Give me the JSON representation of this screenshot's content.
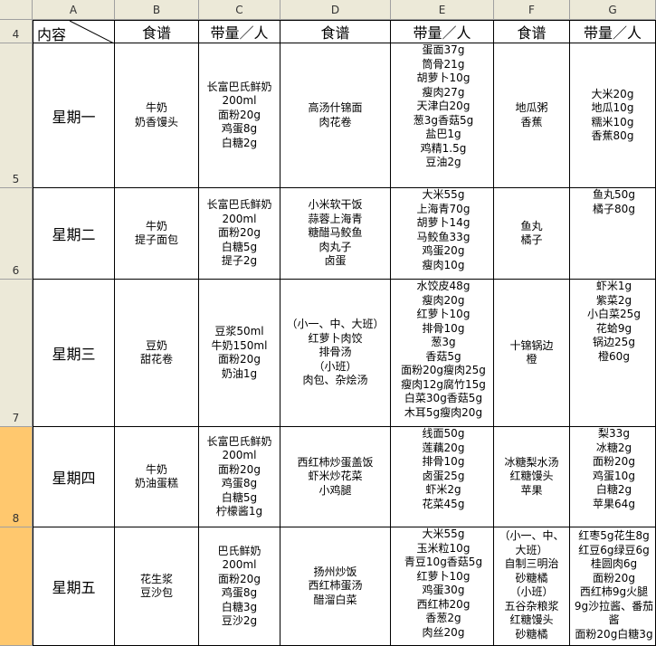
{
  "col_letters": [
    "A",
    "B",
    "C",
    "D",
    "E",
    "F",
    "G"
  ],
  "row_numbers": [
    "4",
    "5",
    "6",
    "7",
    "8"
  ],
  "header_row": {
    "a": "内容",
    "b": "食谱",
    "c": "带量／人",
    "d": "食谱",
    "e": "带量／人",
    "f": "食谱",
    "g": "带量／人"
  },
  "rows": [
    {
      "day": "星期一",
      "b": [
        "牛奶",
        "奶香馒头"
      ],
      "c": [
        "长富巴氏鲜奶",
        "200ml",
        "面粉20g",
        "鸡蛋8g",
        "白糖2g"
      ],
      "d": [
        "高汤什锦面",
        "肉花卷"
      ],
      "e": [
        "蛋面37g",
        "筒骨21g",
        "胡萝卜10g",
        "瘦肉27g",
        "天津白20g",
        "葱3g香菇5g",
        "盐巴1g",
        "鸡精1.5g",
        "豆油2g"
      ],
      "f": [
        "地瓜粥",
        "香蕉"
      ],
      "g": [
        "大米20g",
        "地瓜10g",
        "糯米10g",
        "香蕉80g"
      ]
    },
    {
      "day": "星期二",
      "b": [
        "牛奶",
        "提子面包"
      ],
      "c": [
        "长富巴氏鲜奶",
        "200ml",
        "面粉20g",
        "白糖5g",
        "提子2g"
      ],
      "d": [
        "小米软干饭",
        "蒜蓉上海青",
        "糖醋马鲛鱼",
        "肉丸子",
        "卤蛋"
      ],
      "e": [
        "大米55g",
        "上海青70g",
        "胡萝卜14g",
        "马鲛鱼33g",
        "鸡蛋20g",
        "瘦肉10g"
      ],
      "f": [
        "鱼丸",
        "橘子"
      ],
      "g": [
        "鱼丸50g",
        "橘子80g"
      ]
    },
    {
      "day": "星期三",
      "b": [
        "豆奶",
        "甜花卷"
      ],
      "c": [
        "豆浆50ml",
        "牛奶150ml",
        "面粉20g",
        "奶油1g"
      ],
      "d": [
        "（小一、中、大班）",
        "红萝卜肉饺",
        "排骨汤",
        "（小班）",
        "肉包、杂烩汤"
      ],
      "e": [
        "水饺皮48g",
        "瘦肉20g",
        "红萝卜10g",
        "排骨10g",
        "葱3g",
        "香菇5g",
        "面粉20g瘦肉25g",
        "瘦肉12g腐竹15g",
        "白菜30g香菇5g",
        "木耳5g瘦肉20g"
      ],
      "f": [
        "十锦锅边",
        "橙"
      ],
      "g": [
        "虾米1g",
        "紫菜2g",
        "小白菜25g",
        "花蛤9g",
        "锅边25g",
        "橙60g"
      ]
    },
    {
      "day": "星期四",
      "b": [
        "牛奶",
        "奶油蛋糕"
      ],
      "c": [
        "长富巴氏鲜奶",
        "200ml",
        "面粉20g",
        "鸡蛋8g",
        "白糖5g",
        "柠檬酱1g"
      ],
      "d": [
        "西红柿炒蛋盖饭",
        "虾米炒花菜",
        "小鸡腿"
      ],
      "e": [
        "线面50g",
        "莲藕20g",
        "排骨10g",
        "卤蛋25g",
        "虾米2g",
        "花菜45g"
      ],
      "f": [
        "冰糖梨水汤",
        "红糖馒头",
        "苹果"
      ],
      "g": [
        "梨33g",
        "冰糖2g",
        "面粉20g",
        "鸡蛋10g",
        "白糖2g",
        "苹果64g"
      ]
    },
    {
      "day": "星期五",
      "b": [
        "花生浆",
        "豆沙包"
      ],
      "c": [
        "巴氏鲜奶",
        "200ml",
        "面粉20g",
        "鸡蛋8g",
        "白糖3g",
        "豆沙2g"
      ],
      "d": [
        "扬州炒饭",
        "西红柿蛋汤",
        "醋溜白菜"
      ],
      "e": [
        "大米55g",
        "玉米粒10g",
        "青豆10g香菇5g",
        "红萝卜10g",
        "鸡蛋30g",
        "西红柿20g",
        "香葱2g",
        "肉丝20g"
      ],
      "f": [
        "（小一、中、",
        "大班）",
        "自制三明治",
        "砂糖橘",
        "（小班）",
        "五谷杂粮浆",
        "红糖馒头",
        "砂糖橘"
      ],
      "g": [
        "红枣5g花生8g",
        "红豆6g绿豆6g",
        "桂圆肉6g",
        "面粉20g",
        "西红柿9g火腿",
        "9g沙拉酱、番茄",
        "酱",
        "面粉20g白糖3g"
      ]
    }
  ]
}
